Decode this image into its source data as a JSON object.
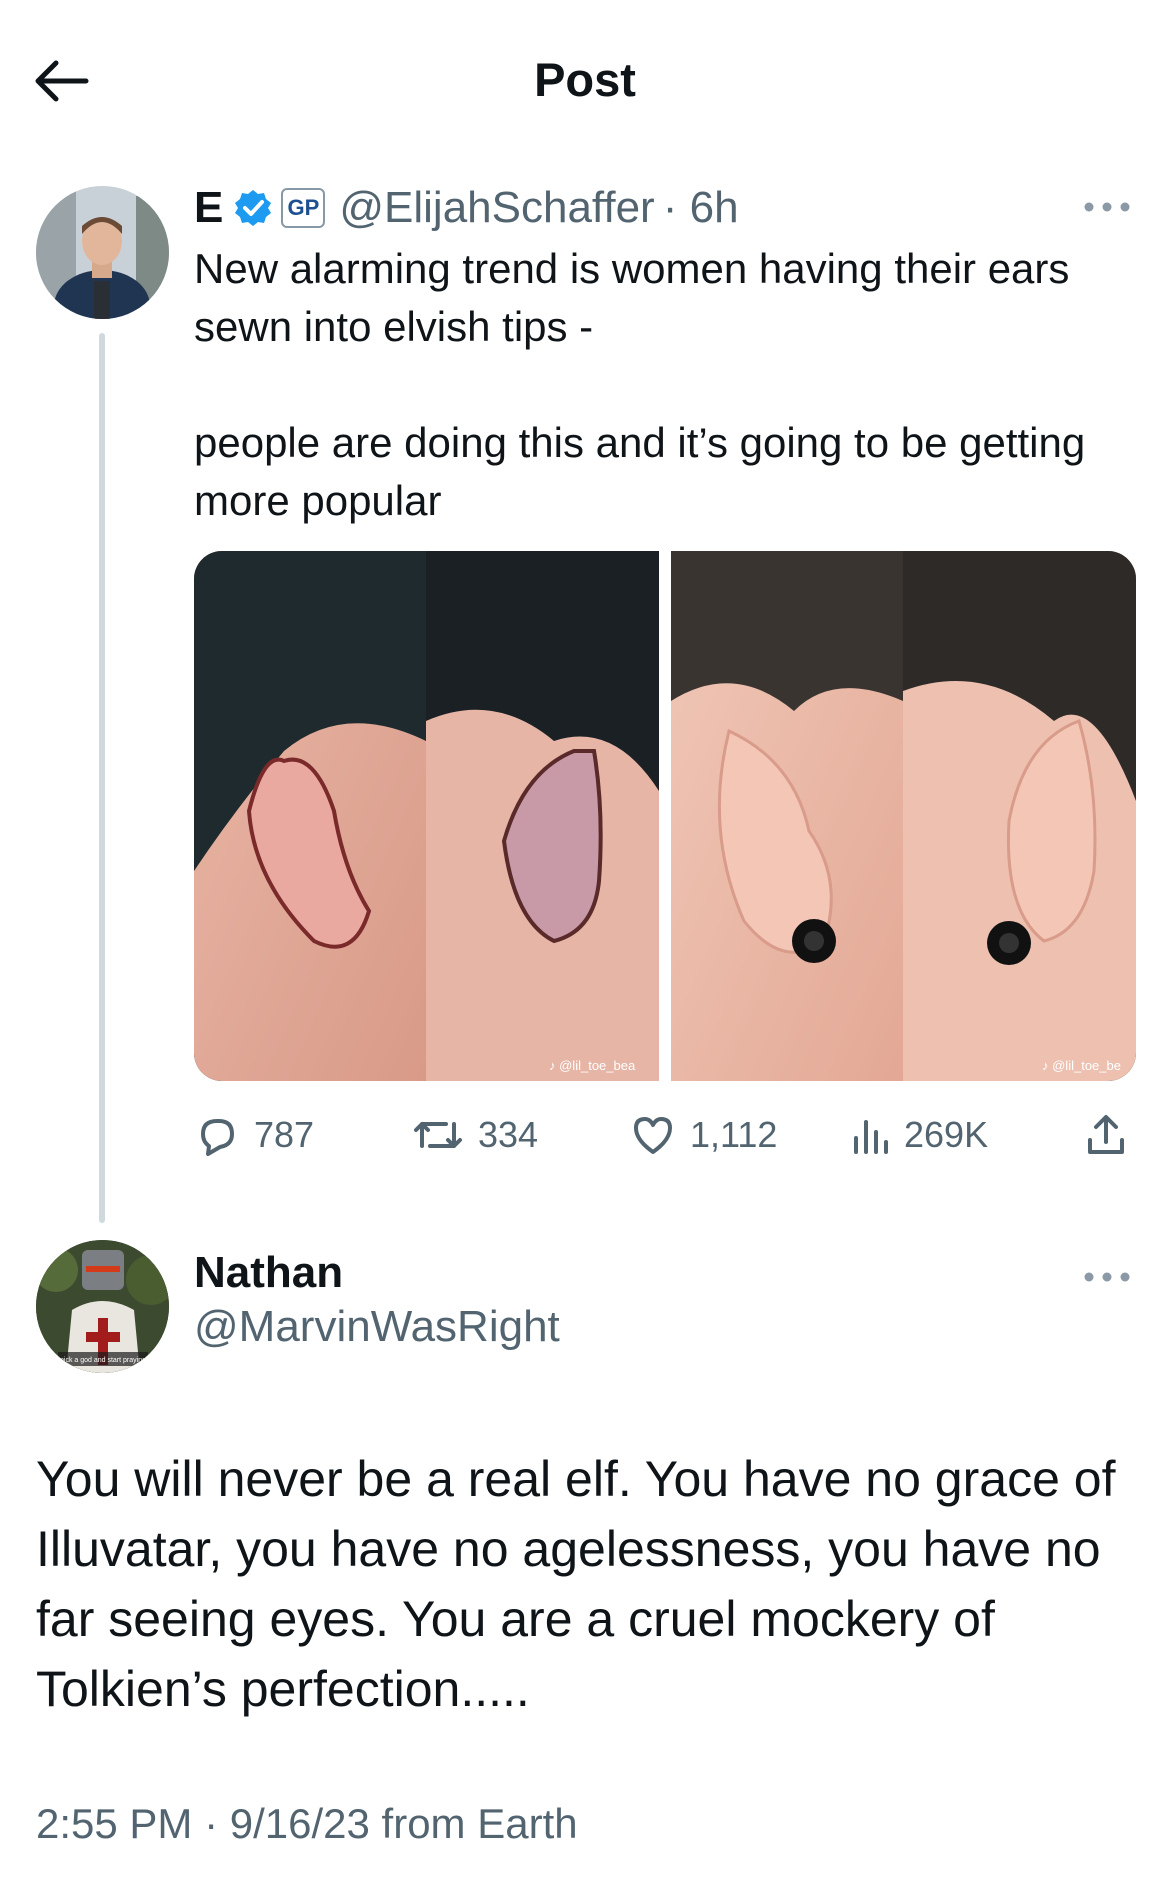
{
  "header": {
    "back_icon": "arrow-left-icon",
    "title": "Post"
  },
  "original_post": {
    "display_name": "E",
    "verified_icon": "verified-badge-icon",
    "affiliate_badge": "GP",
    "handle": "@ElijahSchaffer",
    "time": "· 6h",
    "more_icon": "more-horizontal-icon",
    "text": "New alarming trend is women having their ears sewn into elvish tips -\n\npeople are doing this and it’s going to be getting more popular",
    "media": {
      "left_watermark": "@lil_toe_bea",
      "right_watermark": "@lil_toe_be"
    },
    "stats": {
      "replies": "787",
      "reposts": "334",
      "likes": "1,112",
      "views": "269K"
    }
  },
  "reply": {
    "display_name": "Nathan",
    "handle": "@MarvinWasRight",
    "avatar_caption": "pick a god and start praying",
    "more_icon": "more-horizontal-icon",
    "text": "You will never be a real elf. You have no grace of Illuvatar, you have no agelessness, you have no far seeing eyes. You are a cruel mockery of Tolkien’s perfection.....",
    "meta": "2:55 PM · 9/16/23 from Earth"
  },
  "colors": {
    "text": "#0f1419",
    "secondary": "#536471",
    "verified": "#1d9bf0",
    "thread_line": "#cfd9de"
  }
}
